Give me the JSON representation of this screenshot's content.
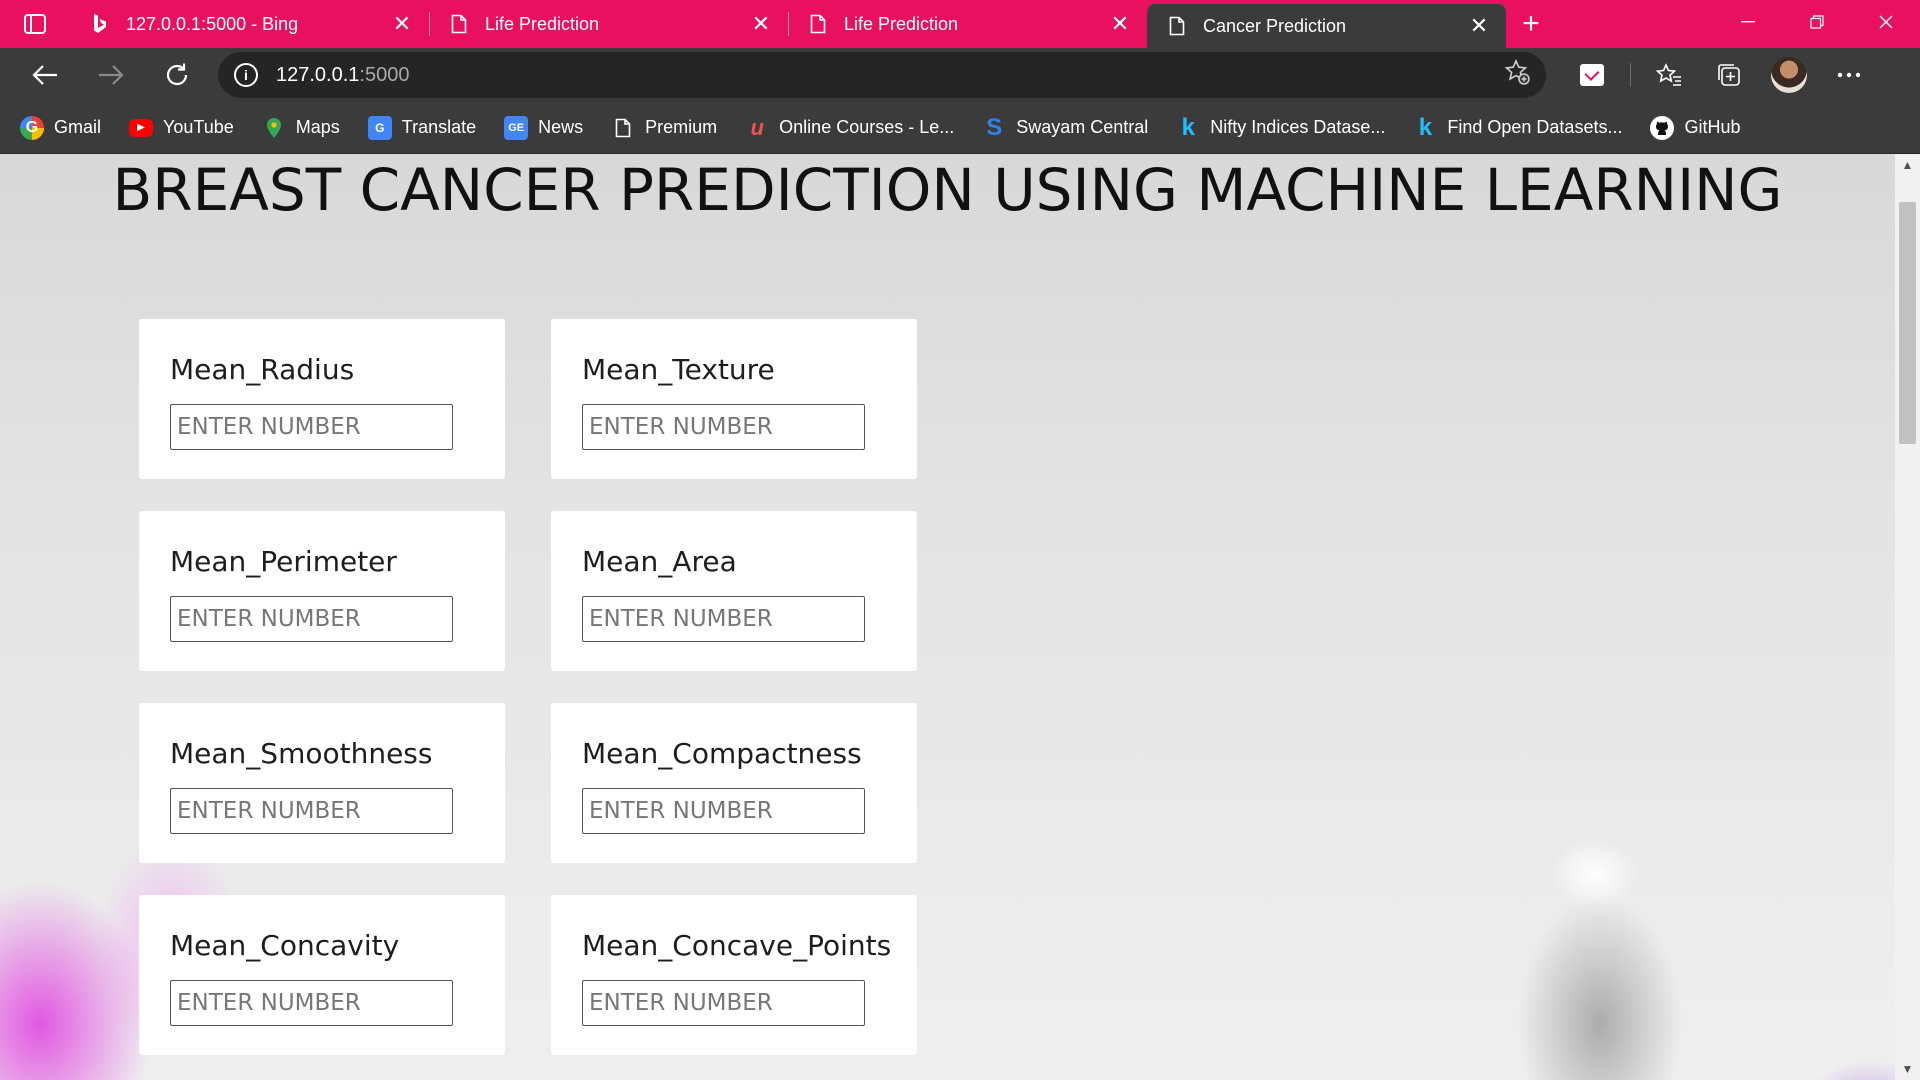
{
  "browser": {
    "tabs": [
      {
        "title": "127.0.0.1:5000 - Bing",
        "icon": "bing-icon",
        "active": false
      },
      {
        "title": "Life Prediction",
        "icon": "page-icon",
        "active": false
      },
      {
        "title": "Life Prediction",
        "icon": "page-icon",
        "active": false
      },
      {
        "title": "Cancer Prediction",
        "icon": "page-icon",
        "active": true
      }
    ],
    "new_tab_symbol": "+",
    "close_symbol": "✕",
    "address": {
      "host": "127.0.0.1",
      "port": ":5000"
    },
    "bookmarks": [
      {
        "label": "Gmail",
        "icon": "google-icon",
        "glyph": "G"
      },
      {
        "label": "YouTube",
        "icon": "youtube-icon",
        "glyph": "▶"
      },
      {
        "label": "Maps",
        "icon": "maps-pin-icon",
        "glyph": "⬤"
      },
      {
        "label": "Translate",
        "icon": "translate-icon",
        "glyph": "G"
      },
      {
        "label": "News",
        "icon": "news-icon",
        "glyph": "GE"
      },
      {
        "label": "Premium",
        "icon": "document-icon",
        "glyph": ""
      },
      {
        "label": "Online Courses - Le...",
        "icon": "udemy-icon",
        "glyph": "u"
      },
      {
        "label": "Swayam Central",
        "icon": "swayam-icon",
        "glyph": "S"
      },
      {
        "label": "Nifty Indices Datase...",
        "icon": "kaggle-icon",
        "glyph": "k"
      },
      {
        "label": "Find Open Datasets...",
        "icon": "kaggle-icon",
        "glyph": "k"
      },
      {
        "label": "GitHub",
        "icon": "github-icon",
        "glyph": "◉"
      }
    ],
    "colors": {
      "tabstrip": "#e8105f",
      "toolbar": "#3b3b3b"
    }
  },
  "page": {
    "title": "BREAST CANCER PREDICTION USING MACHINE LEARNING",
    "placeholder": "ENTER NUMBER",
    "fields": [
      {
        "label": "Mean_Radius"
      },
      {
        "label": "Mean_Texture"
      },
      {
        "label": "Mean_Perimeter"
      },
      {
        "label": "Mean_Area"
      },
      {
        "label": "Mean_Smoothness"
      },
      {
        "label": "Mean_Compactness"
      },
      {
        "label": "Mean_Concavity"
      },
      {
        "label": "Mean_Concave_Points"
      }
    ]
  }
}
